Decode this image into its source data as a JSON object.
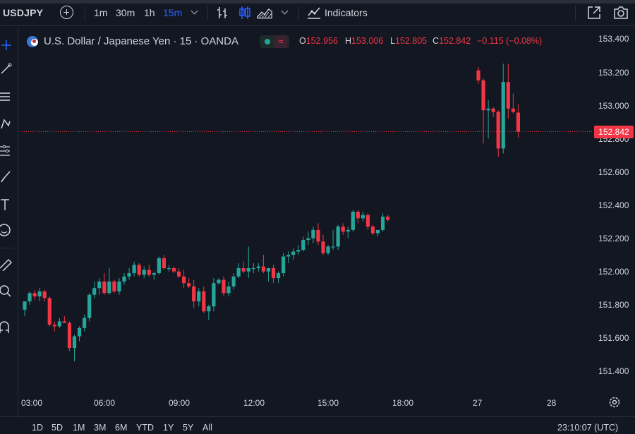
{
  "toolbar": {
    "symbol": "USDJPY",
    "timeframes": [
      "1m",
      "30m",
      "1h",
      "15m"
    ],
    "active_timeframe": "15m",
    "indicators_label": "Indicators"
  },
  "legend": {
    "title": "U.S. Dollar / Japanese Yen · 15 · OANDA",
    "open_key": "O",
    "open": "152.956",
    "high_key": "H",
    "high": "153.006",
    "low_key": "L",
    "low": "152.805",
    "close_key": "C",
    "close": "152.842",
    "change": "−0.115 (−0.08%)",
    "status_wave": "≈"
  },
  "price_axis": {
    "labels": [
      "153.400",
      "153.200",
      "153.000",
      "152.800",
      "152.600",
      "152.400",
      "152.200",
      "152.000",
      "151.800",
      "151.600",
      "151.400"
    ],
    "current_price": "152.842"
  },
  "time_axis": {
    "labels": [
      "03:00",
      "06:00",
      "09:00",
      "12:00",
      "15:00",
      "18:00",
      "27",
      "28"
    ]
  },
  "bottom_bar": {
    "ranges": [
      "1D",
      "5D",
      "1M",
      "3M",
      "6M",
      "YTD",
      "1Y",
      "5Y",
      "All"
    ],
    "clock": "23:10:07 (UTC)"
  },
  "colors": {
    "background": "#131722",
    "up": "#26a69a",
    "down": "#f23645",
    "text": "#d1d4dc",
    "accent": "#2962ff"
  },
  "chart_data": {
    "type": "candlestick",
    "title": "U.S. Dollar / Japanese Yen · 15 · OANDA",
    "y_range": [
      151.3,
      153.45
    ],
    "y_ticks": [
      153.4,
      153.2,
      153.0,
      152.8,
      152.6,
      152.4,
      152.2,
      152.0,
      151.8,
      151.6,
      151.4
    ],
    "x_ticks": [
      "03:00",
      "06:00",
      "09:00",
      "12:00",
      "15:00",
      "18:00",
      "27",
      "28"
    ],
    "last_price": 152.842,
    "candles": [
      {
        "o": 151.77,
        "h": 151.82,
        "l": 151.73,
        "c": 151.82
      },
      {
        "o": 151.82,
        "h": 151.88,
        "l": 151.8,
        "c": 151.87
      },
      {
        "o": 151.87,
        "h": 151.89,
        "l": 151.83,
        "c": 151.85
      },
      {
        "o": 151.85,
        "h": 151.9,
        "l": 151.82,
        "c": 151.88
      },
      {
        "o": 151.88,
        "h": 151.89,
        "l": 151.82,
        "c": 151.84
      },
      {
        "o": 151.84,
        "h": 151.85,
        "l": 151.67,
        "c": 151.68
      },
      {
        "o": 151.68,
        "h": 151.7,
        "l": 151.64,
        "c": 151.67
      },
      {
        "o": 151.67,
        "h": 151.72,
        "l": 151.66,
        "c": 151.7
      },
      {
        "o": 151.7,
        "h": 151.73,
        "l": 151.69,
        "c": 151.69
      },
      {
        "o": 151.69,
        "h": 151.7,
        "l": 151.52,
        "c": 151.54
      },
      {
        "o": 151.54,
        "h": 151.62,
        "l": 151.46,
        "c": 151.61
      },
      {
        "o": 151.61,
        "h": 151.67,
        "l": 151.58,
        "c": 151.66
      },
      {
        "o": 151.66,
        "h": 151.74,
        "l": 151.64,
        "c": 151.72
      },
      {
        "o": 151.72,
        "h": 151.87,
        "l": 151.7,
        "c": 151.86
      },
      {
        "o": 151.86,
        "h": 151.94,
        "l": 151.84,
        "c": 151.9
      },
      {
        "o": 151.9,
        "h": 151.96,
        "l": 151.86,
        "c": 151.94
      },
      {
        "o": 151.94,
        "h": 151.99,
        "l": 151.86,
        "c": 151.87
      },
      {
        "o": 151.87,
        "h": 152.02,
        "l": 151.86,
        "c": 151.94
      },
      {
        "o": 151.94,
        "h": 151.95,
        "l": 151.87,
        "c": 151.88
      },
      {
        "o": 151.88,
        "h": 151.96,
        "l": 151.86,
        "c": 151.94
      },
      {
        "o": 151.94,
        "h": 151.99,
        "l": 151.92,
        "c": 151.97
      },
      {
        "o": 151.97,
        "h": 152.02,
        "l": 151.95,
        "c": 151.99
      },
      {
        "o": 151.99,
        "h": 152.06,
        "l": 151.97,
        "c": 152.04
      },
      {
        "o": 152.04,
        "h": 152.05,
        "l": 151.97,
        "c": 151.98
      },
      {
        "o": 151.98,
        "h": 152.03,
        "l": 151.96,
        "c": 152.01
      },
      {
        "o": 152.01,
        "h": 152.04,
        "l": 151.97,
        "c": 151.98
      },
      {
        "o": 151.98,
        "h": 152.0,
        "l": 151.95,
        "c": 151.99
      },
      {
        "o": 151.99,
        "h": 152.09,
        "l": 151.98,
        "c": 152.08
      },
      {
        "o": 152.08,
        "h": 152.1,
        "l": 152.01,
        "c": 152.02
      },
      {
        "o": 152.02,
        "h": 152.04,
        "l": 152.0,
        "c": 152.02
      },
      {
        "o": 152.02,
        "h": 152.03,
        "l": 151.99,
        "c": 152.0
      },
      {
        "o": 152.0,
        "h": 152.02,
        "l": 151.96,
        "c": 151.97
      },
      {
        "o": 151.97,
        "h": 152.01,
        "l": 151.9,
        "c": 151.93
      },
      {
        "o": 151.93,
        "h": 151.96,
        "l": 151.9,
        "c": 151.91
      },
      {
        "o": 151.91,
        "h": 151.95,
        "l": 151.78,
        "c": 151.82
      },
      {
        "o": 151.82,
        "h": 151.9,
        "l": 151.79,
        "c": 151.88
      },
      {
        "o": 151.88,
        "h": 151.91,
        "l": 151.75,
        "c": 151.76
      },
      {
        "o": 151.76,
        "h": 151.8,
        "l": 151.71,
        "c": 151.79
      },
      {
        "o": 151.79,
        "h": 151.96,
        "l": 151.76,
        "c": 151.93
      },
      {
        "o": 151.93,
        "h": 151.96,
        "l": 151.92,
        "c": 151.95
      },
      {
        "o": 151.95,
        "h": 151.97,
        "l": 151.85,
        "c": 151.87
      },
      {
        "o": 151.87,
        "h": 151.94,
        "l": 151.85,
        "c": 151.91
      },
      {
        "o": 151.91,
        "h": 151.99,
        "l": 151.89,
        "c": 151.97
      },
      {
        "o": 151.97,
        "h": 152.05,
        "l": 151.96,
        "c": 152.02
      },
      {
        "o": 152.02,
        "h": 152.06,
        "l": 151.99,
        "c": 152.0
      },
      {
        "o": 152.0,
        "h": 152.15,
        "l": 151.96,
        "c": 152.02
      },
      {
        "o": 152.02,
        "h": 152.05,
        "l": 151.99,
        "c": 152.02
      },
      {
        "o": 152.02,
        "h": 152.05,
        "l": 152.0,
        "c": 152.03
      },
      {
        "o": 152.03,
        "h": 152.1,
        "l": 151.99,
        "c": 152.0
      },
      {
        "o": 152.0,
        "h": 152.02,
        "l": 151.94,
        "c": 152.02
      },
      {
        "o": 152.02,
        "h": 152.04,
        "l": 151.93,
        "c": 151.96
      },
      {
        "o": 151.96,
        "h": 152.0,
        "l": 151.93,
        "c": 151.99
      },
      {
        "o": 151.99,
        "h": 152.11,
        "l": 151.97,
        "c": 152.09
      },
      {
        "o": 152.09,
        "h": 152.12,
        "l": 152.05,
        "c": 152.1
      },
      {
        "o": 152.1,
        "h": 152.14,
        "l": 152.07,
        "c": 152.12
      },
      {
        "o": 152.12,
        "h": 152.16,
        "l": 152.1,
        "c": 152.13
      },
      {
        "o": 152.13,
        "h": 152.21,
        "l": 152.12,
        "c": 152.19
      },
      {
        "o": 152.19,
        "h": 152.24,
        "l": 152.16,
        "c": 152.2
      },
      {
        "o": 152.2,
        "h": 152.27,
        "l": 152.17,
        "c": 152.25
      },
      {
        "o": 152.25,
        "h": 152.29,
        "l": 152.16,
        "c": 152.18
      },
      {
        "o": 152.18,
        "h": 152.22,
        "l": 152.1,
        "c": 152.11
      },
      {
        "o": 152.11,
        "h": 152.16,
        "l": 152.1,
        "c": 152.15
      },
      {
        "o": 152.15,
        "h": 152.25,
        "l": 152.13,
        "c": 152.15
      },
      {
        "o": 152.15,
        "h": 152.28,
        "l": 152.13,
        "c": 152.27
      },
      {
        "o": 152.27,
        "h": 152.29,
        "l": 152.22,
        "c": 152.24
      },
      {
        "o": 152.24,
        "h": 152.27,
        "l": 152.2,
        "c": 152.25
      },
      {
        "o": 152.25,
        "h": 152.37,
        "l": 152.24,
        "c": 152.36
      },
      {
        "o": 152.36,
        "h": 152.37,
        "l": 152.29,
        "c": 152.32
      },
      {
        "o": 152.32,
        "h": 152.36,
        "l": 152.3,
        "c": 152.34
      },
      {
        "o": 152.34,
        "h": 152.35,
        "l": 152.25,
        "c": 152.27
      },
      {
        "o": 152.27,
        "h": 152.28,
        "l": 152.22,
        "c": 152.23
      },
      {
        "o": 152.23,
        "h": 152.25,
        "l": 152.21,
        "c": 152.25
      },
      {
        "o": 152.25,
        "h": 152.35,
        "l": 152.24,
        "c": 152.33
      },
      {
        "o": 152.33,
        "h": 152.34,
        "l": 152.3,
        "c": 152.31
      },
      {
        "o": 153.21,
        "h": 153.23,
        "l": 153.13,
        "c": 153.15
      },
      {
        "o": 153.15,
        "h": 153.16,
        "l": 152.77,
        "c": 152.97
      },
      {
        "o": 152.97,
        "h": 153.03,
        "l": 152.8,
        "c": 152.98
      },
      {
        "o": 152.98,
        "h": 152.99,
        "l": 152.93,
        "c": 152.96
      },
      {
        "o": 152.96,
        "h": 152.97,
        "l": 152.69,
        "c": 152.74
      },
      {
        "o": 152.74,
        "h": 153.25,
        "l": 152.71,
        "c": 153.14
      },
      {
        "o": 153.14,
        "h": 153.25,
        "l": 152.92,
        "c": 152.98
      },
      {
        "o": 152.98,
        "h": 153.07,
        "l": 152.95,
        "c": 152.96
      },
      {
        "o": 152.956,
        "h": 153.006,
        "l": 152.805,
        "c": 152.842
      }
    ]
  }
}
